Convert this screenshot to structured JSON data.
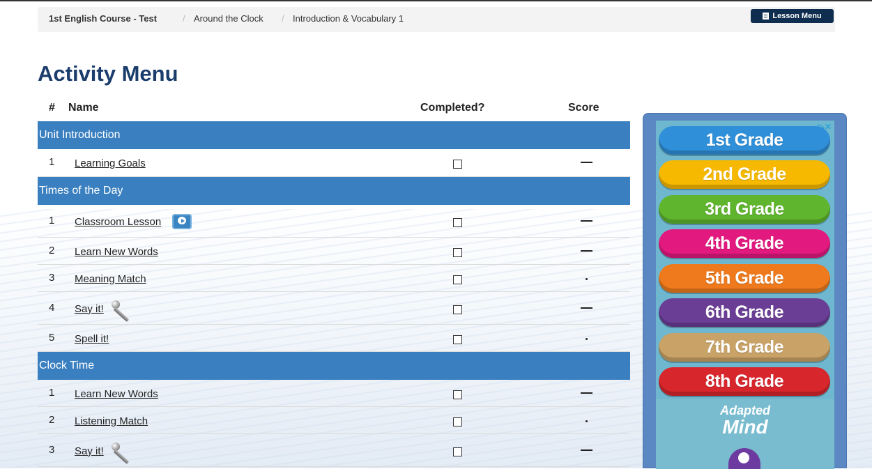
{
  "breadcrumb": {
    "course": "1st English Course - Test",
    "unit": "Around the Clock",
    "lesson": "Introduction & Vocabulary 1",
    "separator": "/"
  },
  "lesson_menu_button": "Lesson Menu",
  "page_title": "Activity Menu",
  "headers": {
    "num": "#",
    "name": "Name",
    "completed": "Completed?",
    "score": "Score"
  },
  "sections": [
    {
      "title": "Unit Introduction",
      "rows": [
        {
          "num": "1",
          "name": "Learning Goals",
          "icon": "",
          "score": "dash"
        }
      ]
    },
    {
      "title": "Times of the Day",
      "rows": [
        {
          "num": "1",
          "name": "Classroom Lesson",
          "icon": "video-icon",
          "score": "dash"
        },
        {
          "num": "2",
          "name": "Learn New Words",
          "icon": "",
          "score": "dash"
        },
        {
          "num": "3",
          "name": "Meaning Match",
          "icon": "",
          "score": "dot"
        },
        {
          "num": "4",
          "name": "Say it!",
          "icon": "microphone-icon",
          "score": "dash"
        },
        {
          "num": "5",
          "name": "Spell it!",
          "icon": "",
          "score": "dot"
        }
      ]
    },
    {
      "title": "Clock Time",
      "rows": [
        {
          "num": "1",
          "name": "Learn New Words",
          "icon": "",
          "score": "dash"
        },
        {
          "num": "2",
          "name": "Listening Match",
          "icon": "",
          "score": "dot"
        },
        {
          "num": "3",
          "name": "Say it!",
          "icon": "microphone-icon",
          "score": "dash"
        }
      ]
    }
  ],
  "ad": {
    "grades": [
      {
        "label": "1st Grade",
        "color": "#2f8fd8"
      },
      {
        "label": "2nd Grade",
        "color": "#f7b900"
      },
      {
        "label": "3rd Grade",
        "color": "#5fb52e"
      },
      {
        "label": "4th Grade",
        "color": "#e2197e"
      },
      {
        "label": "5th Grade",
        "color": "#ee7a1d"
      },
      {
        "label": "6th Grade",
        "color": "#6b3e96"
      },
      {
        "label": "7th Grade",
        "color": "#c8a266"
      },
      {
        "label": "8th Grade",
        "color": "#d7262c"
      }
    ],
    "brand_line1": "Adapted",
    "brand_line2": "Mind",
    "close_glyph": "▷✕"
  },
  "colors": {
    "accent": "#3a7fbf",
    "title": "#1a3d6b",
    "button": "#0e2d4f"
  }
}
